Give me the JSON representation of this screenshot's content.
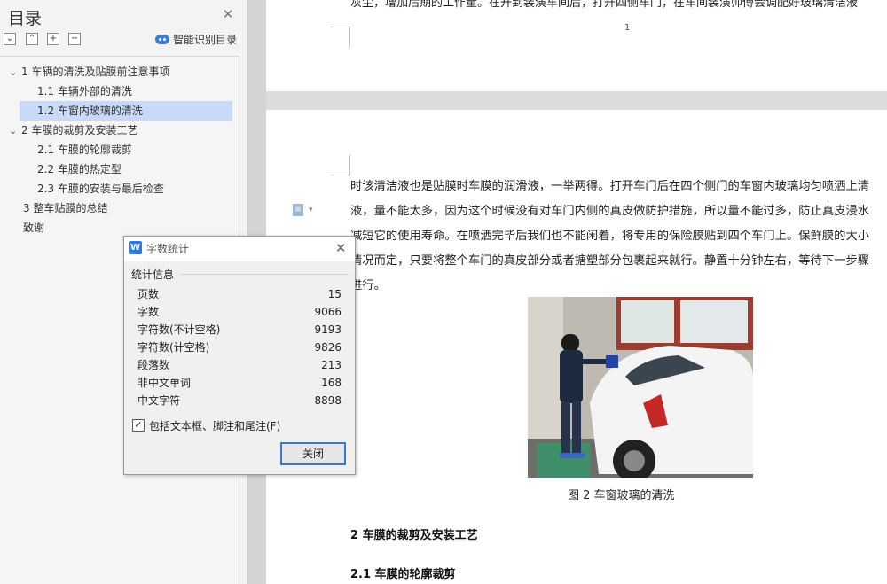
{
  "sidebar": {
    "title": "目录",
    "smart_label": "智能识别目录",
    "toc": [
      {
        "label": "1 车辆的清洗及贴膜前注意事项",
        "level": 1,
        "expanded": true
      },
      {
        "label": "1.1 车辆外部的清洗",
        "level": 2
      },
      {
        "label": "1.2 车窗内玻璃的清洗",
        "level": 2,
        "selected": true
      },
      {
        "label": "2 车膜的裁剪及安装工艺",
        "level": 1,
        "expanded": true
      },
      {
        "label": "2.1 车膜的轮廓裁剪",
        "level": 2
      },
      {
        "label": "2.2 车膜的热定型",
        "level": 2
      },
      {
        "label": "2.3 车膜的安装与最后检查",
        "level": 2
      },
      {
        "label": "3 整车贴膜的总结",
        "level": 1
      },
      {
        "label": "致谢",
        "level": 1
      }
    ]
  },
  "document": {
    "page1_text": "灰尘，增加后期的工作量。在开到装潢车间后，打开四侧车门，在车间装潢师傅会调配好玻璃清洁液",
    "page1_number": "1",
    "body_lines": [
      "时该清洁液也是贴膜时车膜的润滑液，一举两得。打开车门后在四个侧门的车窗内玻璃均匀喷洒上清",
      "液，量不能太多，因为这个时候没有对车门内侧的真皮做防护措施，所以量不能过多，防止真皮浸水",
      "减短它的使用寿命。在喷洒完毕后我们也不能闲着，将专用的保险膜贴到四个车门上。保鲜膜的大小",
      "情况而定，只要将整个车门的真皮部分或者搪塑部分包裹起来就行。静置十分钟左右，等待下一步骤",
      "进行。"
    ],
    "caption": "图 2 车窗玻璃的清洗",
    "heading1": "2 车膜的裁剪及安装工艺",
    "heading2": "2.1 车膜的轮廓裁剪"
  },
  "dialog": {
    "title": "字数统计",
    "group_label": "统计信息",
    "stats": [
      {
        "label": "页数",
        "value": "15"
      },
      {
        "label": "字数",
        "value": "9066"
      },
      {
        "label": "字符数(不计空格)",
        "value": "9193"
      },
      {
        "label": "字符数(计空格)",
        "value": "9826"
      },
      {
        "label": "段落数",
        "value": "213"
      },
      {
        "label": "非中文单词",
        "value": "168"
      },
      {
        "label": "中文字符",
        "value": "8898"
      }
    ],
    "checkbox_label": "包括文本框、脚注和尾注(F)",
    "checkbox_checked": true,
    "close_label": "关闭"
  }
}
